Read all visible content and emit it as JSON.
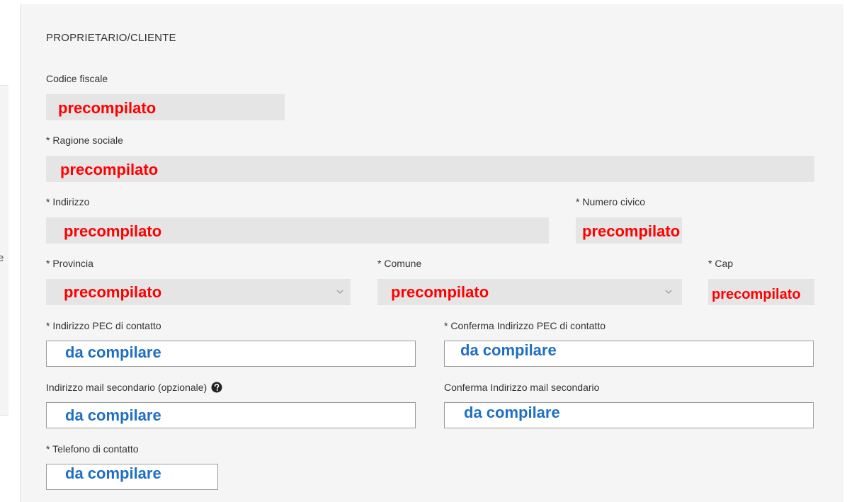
{
  "section": {
    "title": "PROPRIETARIO/CLIENTE"
  },
  "left_strip": {
    "fragment": "e"
  },
  "fields": {
    "codice_fiscale": {
      "label": "Codice fiscale",
      "value": "precompilato"
    },
    "ragione_sociale": {
      "label": "* Ragione sociale",
      "value": "precompilato"
    },
    "indirizzo": {
      "label": "* Indirizzo",
      "value": "precompilato"
    },
    "numero_civico": {
      "label": "* Numero civico",
      "value": "precompilato"
    },
    "provincia": {
      "label": "* Provincia",
      "value": "precompilato"
    },
    "comune": {
      "label": "* Comune",
      "value": "precompilato"
    },
    "cap": {
      "label": "* Cap",
      "value": "precompilato"
    },
    "pec": {
      "label": "* Indirizzo PEC di contatto",
      "value": "da compilare"
    },
    "pec_conferma": {
      "label": "* Conferma Indirizzo PEC di contatto",
      "value": "da compilare"
    },
    "mail_secondaria": {
      "label": "Indirizzo mail secondario (opzionale)",
      "value": "da compilare"
    },
    "mail_secondaria_conferma": {
      "label": "Conferma Indirizzo mail secondario",
      "value": "da compilare"
    },
    "telefono": {
      "label": "* Telefono di contatto",
      "value": "da compilare"
    }
  },
  "colors": {
    "prefilled_annotation": "#ff0000",
    "to_fill_annotation": "#1f6fc4",
    "readonly_field_bg": "#e5e5e5",
    "panel_bg": "#f5f5f5"
  },
  "icons": {
    "help": "question-circle-icon",
    "select_arrow": "chevron-down-icon"
  }
}
